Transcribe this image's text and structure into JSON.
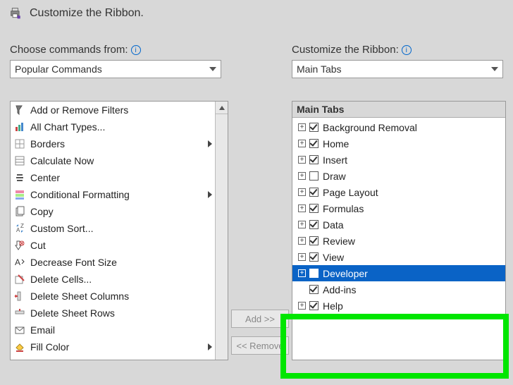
{
  "header": {
    "title": "Customize the Ribbon."
  },
  "labels": {
    "choose_from": "Choose commands from:",
    "customize": "Customize the Ribbon:"
  },
  "dropdowns": {
    "left": "Popular Commands",
    "right": "Main Tabs"
  },
  "commands": [
    {
      "label": "Add or Remove Filters",
      "submenu": false
    },
    {
      "label": "All Chart Types...",
      "submenu": false
    },
    {
      "label": "Borders",
      "submenu": true
    },
    {
      "label": "Calculate Now",
      "submenu": false
    },
    {
      "label": "Center",
      "submenu": false
    },
    {
      "label": "Conditional Formatting",
      "submenu": true
    },
    {
      "label": "Copy",
      "submenu": false
    },
    {
      "label": "Custom Sort...",
      "submenu": false
    },
    {
      "label": "Cut",
      "submenu": false
    },
    {
      "label": "Decrease Font Size",
      "submenu": false
    },
    {
      "label": "Delete Cells...",
      "submenu": false
    },
    {
      "label": "Delete Sheet Columns",
      "submenu": false
    },
    {
      "label": "Delete Sheet Rows",
      "submenu": false
    },
    {
      "label": "Email",
      "submenu": false
    },
    {
      "label": "Fill Color",
      "submenu": true
    }
  ],
  "tree": {
    "header": "Main Tabs",
    "items": [
      {
        "label": "Background Removal",
        "checked": true
      },
      {
        "label": "Home",
        "checked": true
      },
      {
        "label": "Insert",
        "checked": true
      },
      {
        "label": "Draw",
        "checked": false
      },
      {
        "label": "Page Layout",
        "checked": true
      },
      {
        "label": "Formulas",
        "checked": true
      },
      {
        "label": "Data",
        "checked": true
      },
      {
        "label": "Review",
        "checked": true
      },
      {
        "label": "View",
        "checked": true
      },
      {
        "label": "Developer",
        "checked": true,
        "selected": true
      },
      {
        "label": "Add-ins",
        "checked": true,
        "indent": true
      },
      {
        "label": "Help",
        "checked": true,
        "partial": true
      }
    ]
  },
  "buttons": {
    "add": "Add >>",
    "remove": "<< Remove"
  }
}
